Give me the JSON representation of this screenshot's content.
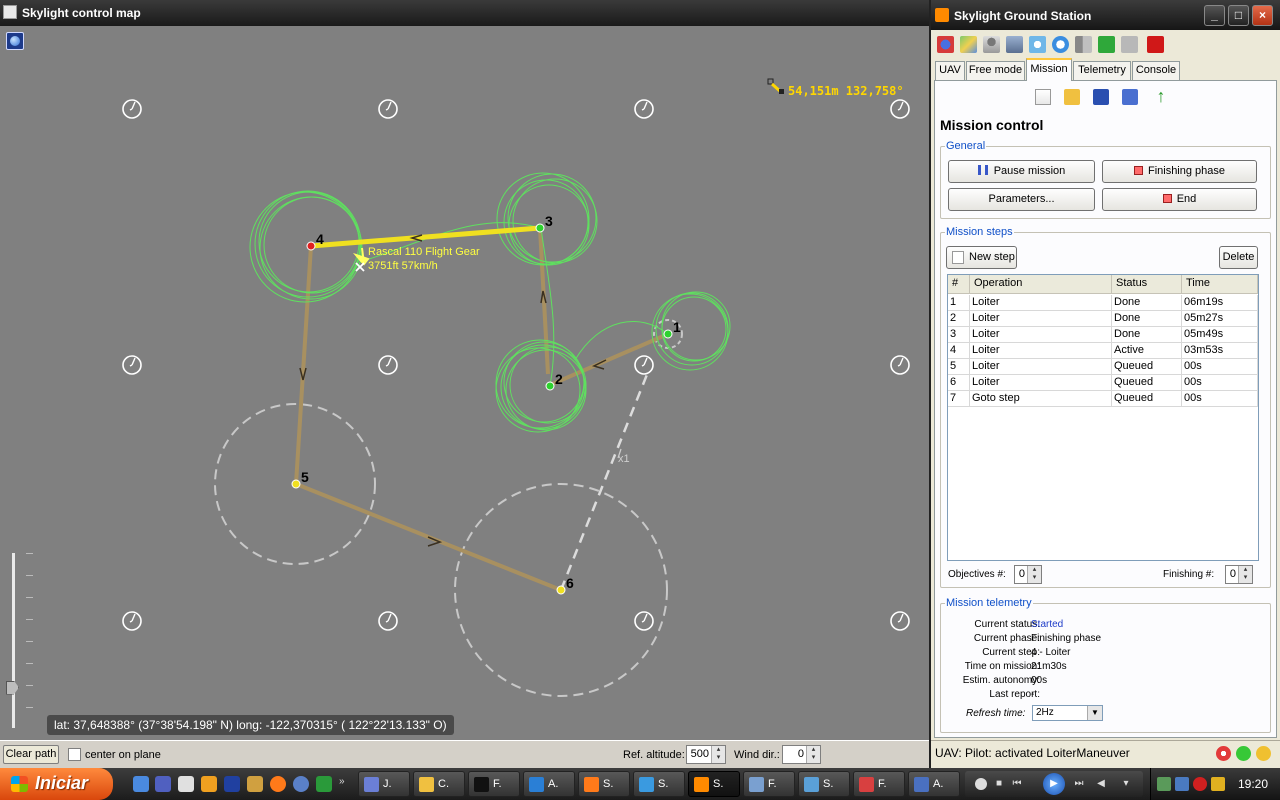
{
  "map_window": {
    "title": "Skylight control map",
    "scale_text": "54,151m 132,758°",
    "aircraft_name": "Rascal 110 Flight Gear",
    "aircraft_status": "3751ft 57km/h",
    "coordinates": "lat: 37,648388° (37°38'54.198\" N)   long: -122,370315° ( 122°22'13.133\" O)",
    "waypoints": [
      {
        "label": "1",
        "state": "done"
      },
      {
        "label": "2",
        "state": "done"
      },
      {
        "label": "3",
        "state": "done"
      },
      {
        "label": "4",
        "state": "active"
      },
      {
        "label": "5",
        "state": "queued"
      },
      {
        "label": "6",
        "state": "queued"
      }
    ],
    "goto_label": "x1",
    "zoom_level": 0.85,
    "bottom": {
      "clear_path": "Clear path",
      "center_on_plane": "center on plane",
      "center_on_plane_checked": false,
      "ref_altitude_label": "Ref. altitude:",
      "ref_altitude_value": "500",
      "wind_dir_label": "Wind dir.:",
      "wind_dir_value": "0"
    }
  },
  "station": {
    "title": "Skylight Ground Station",
    "window_controls": [
      "_",
      "□",
      "×"
    ],
    "tabs": [
      "UAV",
      "Free mode",
      "Mission",
      "Telemetry",
      "Console"
    ],
    "active_tab": "Mission",
    "heading": "Mission control",
    "general": {
      "legend": "General",
      "pause": "Pause mission",
      "finishing": "Finishing phase",
      "parameters": "Parameters...",
      "end": "End"
    },
    "steps": {
      "legend": "Mission steps",
      "new_step": "New step",
      "delete": "Delete",
      "columns": [
        "#",
        "Operation",
        "Status",
        "Time"
      ],
      "rows": [
        [
          "1",
          "Loiter",
          "Done",
          "06m19s"
        ],
        [
          "2",
          "Loiter",
          "Done",
          "05m27s"
        ],
        [
          "3",
          "Loiter",
          "Done",
          "05m49s"
        ],
        [
          "4",
          "Loiter",
          "Active",
          "03m53s"
        ],
        [
          "5",
          "Loiter",
          "Queued",
          "00s"
        ],
        [
          "6",
          "Loiter",
          "Queued",
          "00s"
        ],
        [
          "7",
          "Goto step",
          "Queued",
          "00s"
        ]
      ],
      "objectives_label": "Objectives #:",
      "objectives_value": "0",
      "finishing_label": "Finishing #:",
      "finishing_value": "0"
    },
    "telemetry": {
      "legend": "Mission telemetry",
      "fields": [
        {
          "label": "Current status:",
          "value": "Started"
        },
        {
          "label": "Current phase:",
          "value": "Finishing phase"
        },
        {
          "label": "Current step:",
          "value": "4 - Loiter"
        },
        {
          "label": "Time on mission:",
          "value": "21m30s"
        },
        {
          "label": "Estim. autonomy:",
          "value": "00s"
        },
        {
          "label": "Last report:",
          "value": "-"
        }
      ],
      "refresh_label": "Refresh time:",
      "refresh_value": "2Hz"
    },
    "status_bar": "UAV: Pilot: activated LoiterManeuver"
  },
  "taskbar": {
    "start": "Iniciar",
    "tasks": [
      {
        "label": "J.",
        "color": "#6b7fd6"
      },
      {
        "label": "C.",
        "color": "#f0c040"
      },
      {
        "label": "F.",
        "color": "#111111"
      },
      {
        "label": "A.",
        "color": "#2a7fd6"
      },
      {
        "label": "S.",
        "color": "#ff7a1a"
      },
      {
        "label": "S.",
        "color": "#3a9ae0"
      },
      {
        "label": "S.",
        "color": "#ff8a00"
      },
      {
        "label": "F.",
        "color": "#7aa0d0"
      },
      {
        "label": "S.",
        "color": "#5aa0d8"
      },
      {
        "label": "F.",
        "color": "#d84040"
      },
      {
        "label": "A.",
        "color": "#4a70c0"
      }
    ],
    "clock": "19:20"
  },
  "colors": {
    "map_bg": "#808080",
    "loiter_green": "#5fe05f",
    "active_path": "#f0e020",
    "planned_path": "#a89060",
    "telemetry_value_blue": "#1e3cc8"
  }
}
